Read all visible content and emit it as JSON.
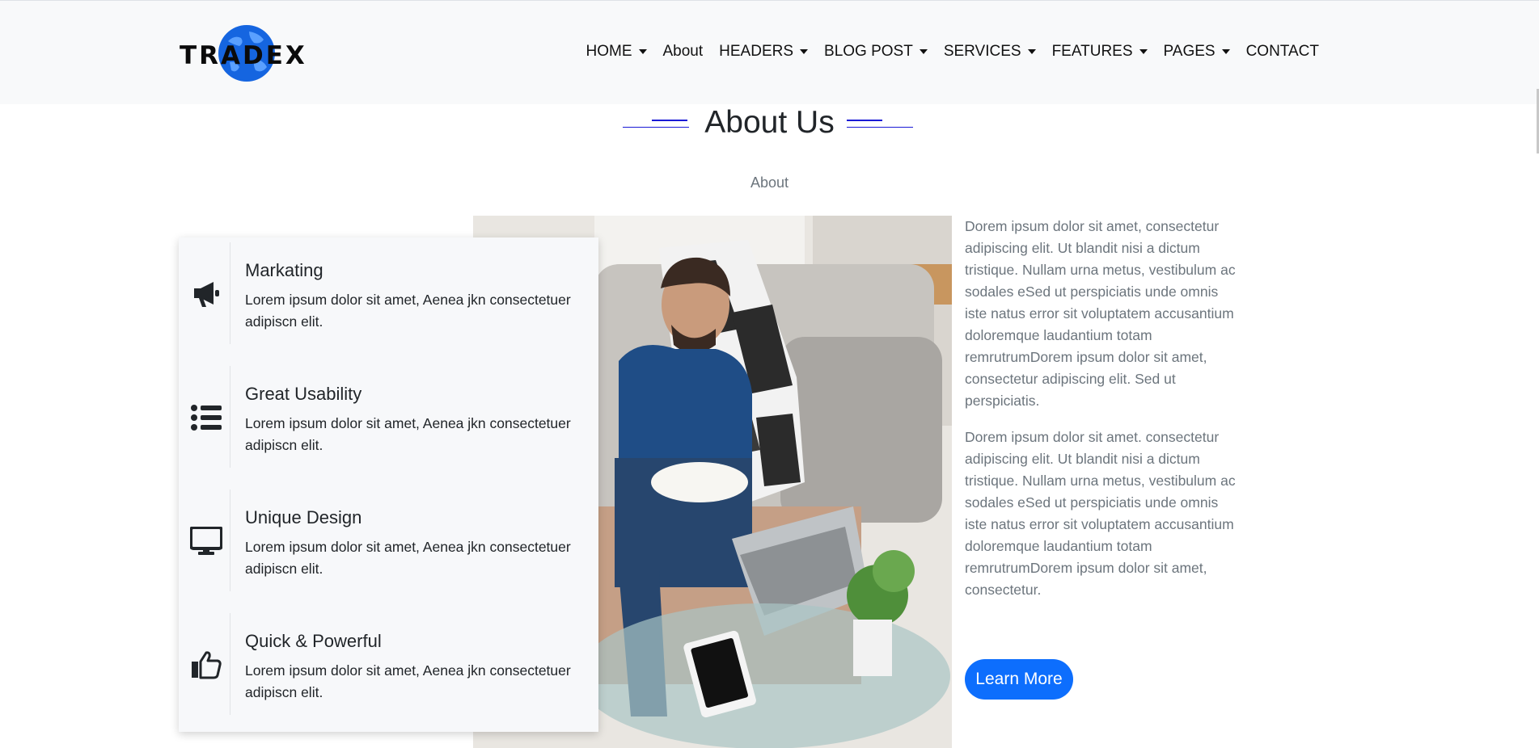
{
  "brand": {
    "logo_text": "TRADEX",
    "logo_color": "#0b0b0b",
    "globe_color": "#1565e0"
  },
  "nav": {
    "items": [
      {
        "label": "HOME",
        "dropdown": true
      },
      {
        "label": "About",
        "dropdown": false
      },
      {
        "label": "HEADERS",
        "dropdown": true
      },
      {
        "label": "BLOG POST",
        "dropdown": true
      },
      {
        "label": "SERVICES",
        "dropdown": true
      },
      {
        "label": "FEATURES",
        "dropdown": true
      },
      {
        "label": "PAGES",
        "dropdown": true
      },
      {
        "label": "CONTACT",
        "dropdown": false
      }
    ]
  },
  "section": {
    "title": "About Us",
    "subtitle": "About",
    "accent_color": "#1a1ad6"
  },
  "features": [
    {
      "icon": "megaphone-icon",
      "title": "Markating",
      "desc": "Lorem ipsum dolor sit amet, Aenea jkn consectetuer adipiscn elit."
    },
    {
      "icon": "list-icon",
      "title": "Great Usability",
      "desc": "Lorem ipsum dolor sit amet, Aenea jkn consectetuer adipiscn elit."
    },
    {
      "icon": "monitor-icon",
      "title": "Unique Design",
      "desc": "Lorem ipsum dolor sit amet, Aenea jkn consectetuer adipiscn elit."
    },
    {
      "icon": "thumbs-up-icon",
      "title": "Quick & Powerful",
      "desc": "Lorem ipsum dolor sit amet, Aenea jkn consectetuer adipiscn elit."
    }
  ],
  "about": {
    "paragraphs": [
      "Dorem ipsum dolor sit amet, consectetur adipiscing elit. Ut blandit nisi a dictum tristique. Nullam urna metus, vestibulum ac sodales eSed ut perspiciatis unde omnis iste natus error sit voluptatem accusantium doloremque laudantium totam remrutrumDorem ipsum dolor sit amet, consectetur adipiscing elit. Sed ut perspiciatis.",
      "Dorem ipsum dolor sit amet. consectetur adipiscing elit. Ut blandit nisi a dictum tristique. Nullam urna metus, vestibulum ac sodales eSed ut perspiciatis unde omnis iste natus error sit voluptatem accusantium doloremque laudantium totam remrutrumDorem ipsum dolor sit amet, consectetur."
    ],
    "button_label": "Learn More",
    "button_color": "#0d6efd"
  }
}
